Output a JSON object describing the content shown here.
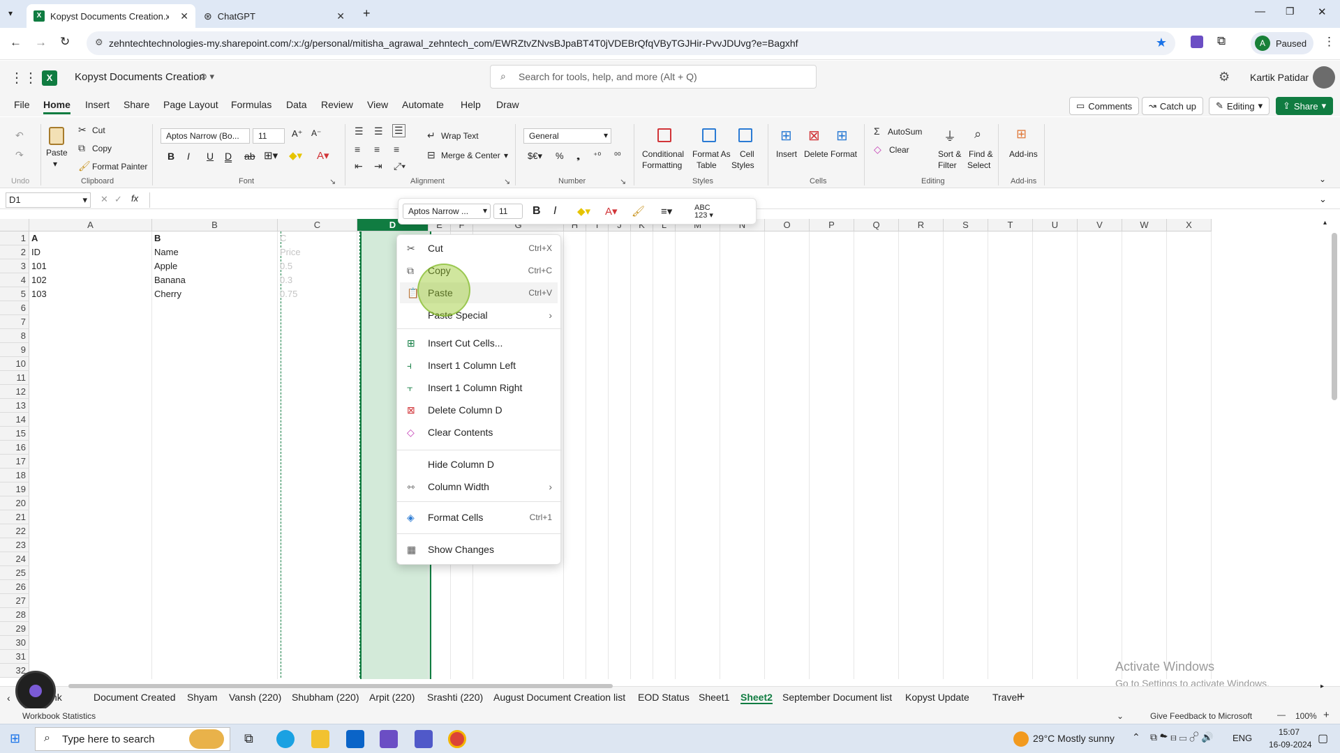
{
  "browser": {
    "tabs": [
      {
        "title": "Kopyst Documents Creation.xls"
      },
      {
        "title": "ChatGPT"
      }
    ],
    "url": "zehntechtechnologies-my.sharepoint.com/:x:/g/personal/mitisha_agrawal_zehntech_com/EWRZtvZNvsBJpaBT4T0jVDEBrQfqVByTGJHir-PvvJDUvg?e=Bagxhf",
    "profile": "Paused",
    "profile_initial": "A"
  },
  "app": {
    "doc_title": "Kopyst Documents Creation",
    "search_placeholder": "Search for tools, help, and more (Alt + Q)",
    "user": "Kartik Patidar"
  },
  "menu": {
    "items": [
      "File",
      "Home",
      "Insert",
      "Share",
      "Page Layout",
      "Formulas",
      "Data",
      "Review",
      "View",
      "Automate",
      "Help",
      "Draw"
    ],
    "comments": "Comments",
    "catchup": "Catch up",
    "editing": "Editing",
    "share": "Share"
  },
  "ribbon": {
    "undo": "Undo",
    "paste": "Paste",
    "cut": "Cut",
    "copy": "Copy",
    "format_painter": "Format Painter",
    "clipboard": "Clipboard",
    "font_name": "Aptos Narrow (Bo...",
    "font_size": "11",
    "font": "Font",
    "wrap": "Wrap Text",
    "merge": "Merge & Center",
    "alignment": "Alignment",
    "number_format": "General",
    "number": "Number",
    "cond1": "Conditional",
    "cond2": "Formatting",
    "fat1": "Format As",
    "fat2": "Table",
    "cs1": "Cell",
    "cs2": "Styles",
    "styles": "Styles",
    "insert": "Insert",
    "delete": "Delete",
    "format": "Format",
    "cells": "Cells",
    "autosum": "AutoSum",
    "clear": "Clear",
    "sort1": "Sort &",
    "sort2": "Filter",
    "find1": "Find &",
    "find2": "Select",
    "editing": "Editing",
    "addins": "Add-ins"
  },
  "formula_bar": {
    "name_box": "D1",
    "content": ""
  },
  "grid": {
    "columns": [
      "A",
      "B",
      "C",
      "D",
      "E",
      "F",
      "G",
      "H",
      "I",
      "J",
      "K",
      "L",
      "M",
      "N",
      "O",
      "P",
      "Q",
      "R",
      "S",
      "T",
      "U",
      "V",
      "W",
      "X"
    ],
    "rows": [
      "1",
      "2",
      "3",
      "4",
      "5",
      "6",
      "7",
      "8",
      "9",
      "10",
      "11",
      "12",
      "13",
      "14",
      "15",
      "16",
      "17",
      "18",
      "19",
      "20",
      "21",
      "22",
      "23",
      "24",
      "25",
      "26",
      "27",
      "28",
      "29",
      "30",
      "31",
      "32"
    ],
    "cells": {
      "a1": "A",
      "b1": "B",
      "c1": "C",
      "a2": "ID",
      "b2": "Name",
      "c2": "Price",
      "a3": "101",
      "b3": "Apple",
      "c3": "0.5",
      "a4": "102",
      "b4": "Banana",
      "c4": "0.3",
      "a5": "103",
      "b5": "Cherry",
      "c5": "0.75"
    }
  },
  "minibar": {
    "font": "Aptos Narrow ...",
    "size": "11"
  },
  "context_menu": {
    "items": [
      {
        "label": "Cut",
        "shortcut": "Ctrl+X"
      },
      {
        "label": "Copy",
        "shortcut": "Ctrl+C"
      },
      {
        "label": "Paste",
        "shortcut": "Ctrl+V"
      },
      {
        "label": "Paste Special",
        "shortcut": ""
      },
      {
        "label": "Insert Cut Cells...",
        "shortcut": ""
      },
      {
        "label": "Insert 1 Column Left",
        "shortcut": ""
      },
      {
        "label": "Insert 1 Column Right",
        "shortcut": ""
      },
      {
        "label": "Delete Column D",
        "shortcut": ""
      },
      {
        "label": "Clear Contents",
        "shortcut": ""
      },
      {
        "label": "Hide Column D",
        "shortcut": ""
      },
      {
        "label": "Column Width",
        "shortcut": ""
      },
      {
        "label": "Format Cells",
        "shortcut": "Ctrl+1"
      },
      {
        "label": "Show Changes",
        "shortcut": ""
      }
    ]
  },
  "sheet_tabs": [
    "nk",
    "Document Created",
    "Shyam",
    "Vansh (220)",
    "Shubham (220)",
    "Arpit (220)",
    "Srashti (220)",
    "August Document Creation list",
    "EOD Status",
    "Sheet1",
    "Sheet2",
    "September Document list",
    "Kopyst Update",
    "Travel"
  ],
  "watermark": {
    "line1": "Activate Windows",
    "line2": "Go to Settings to activate Windows."
  },
  "status": {
    "left": "Workbook Statistics",
    "feedback": "Give Feedback to Microsoft",
    "zoom": "100%"
  },
  "taskbar": {
    "search": "Type here to search",
    "weather": "29°C  Mostly sunny",
    "lang": "ENG",
    "time": "15:07",
    "date": "16-09-2024"
  },
  "colors": {
    "excel_green": "#107c41",
    "selected_col": "#d3ead9"
  }
}
